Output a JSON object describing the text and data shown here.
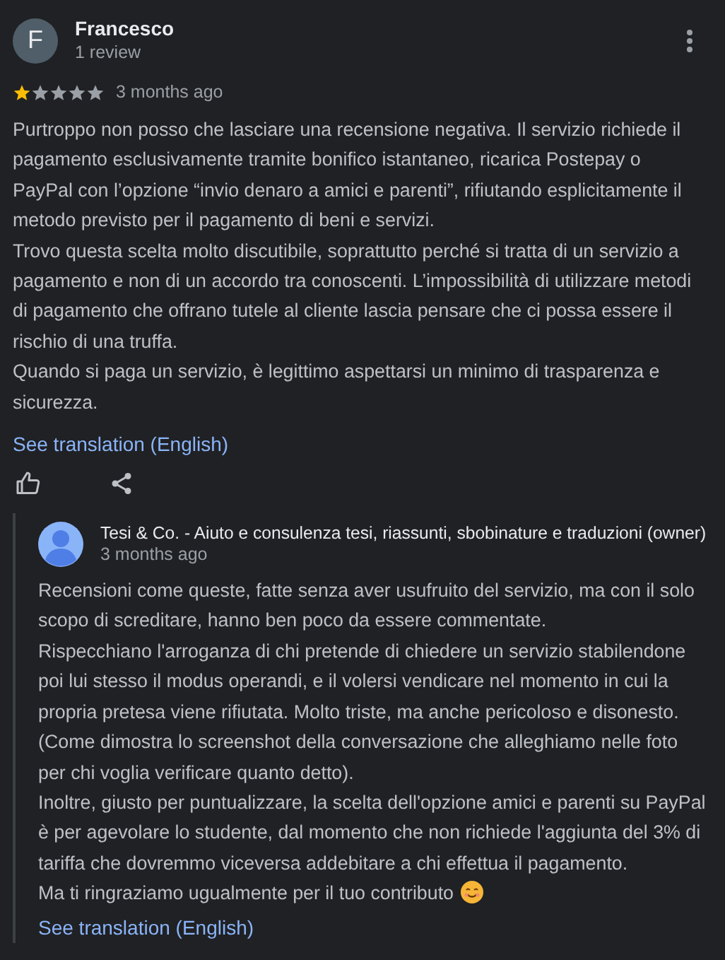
{
  "review": {
    "avatar_letter": "F",
    "author": "Francesco",
    "meta": "1 review",
    "stars": 1,
    "time": "3 months ago",
    "paragraphs": [
      "Purtroppo non posso che lasciare una recensione negativa. Il servizio richiede il pagamento esclusivamente tramite bonifico istantaneo, ricarica Postepay o PayPal con l’opzione “invio denaro a amici e parenti”, rifiutando esplicitamente il metodo previsto per il pagamento di beni e servizi.",
      "Trovo questa scelta molto discutibile, soprattutto perché si tratta di un servizio a pagamento e non di un accordo tra conoscenti. L’impossibilità di utilizzare metodi di pagamento che offrano tutele al cliente lascia pensare che ci possa essere il rischio di una truffa.",
      "Quando si paga un servizio, è legittimo aspettarsi un minimo di trasparenza e sicurezza."
    ],
    "translation_link": "See translation (English)"
  },
  "reply": {
    "author": "Tesi & Co. - Aiuto e consulenza tesi, riassunti, sbobinature e traduzioni (owner)",
    "time": "3 months ago",
    "paragraphs": [
      "Recensioni come queste, fatte senza aver usufruito del servizio, ma con il solo scopo di screditare, hanno ben poco da essere commentate.",
      "Rispecchiano l'arroganza di chi pretende di chiedere un servizio stabilendone poi lui stesso il modus operandi, e il volersi vendicare nel momento in cui la propria pretesa viene rifiutata. Molto triste, ma anche pericoloso e disonesto. (Come dimostra lo screenshot della conversazione che alleghiamo nelle foto per chi voglia verificare quanto detto).",
      "Inoltre, giusto per puntualizzare, la scelta dell'opzione amici e parenti su PayPal è per agevolare lo studente, dal momento che non richiede l'aggiunta del 3% di tariffa che dovremmo viceversa addebitare a chi effettua il pagamento.",
      "Ma ti ringraziamo ugualmente per il tuo contributo"
    ],
    "translation_link": "See translation (English)"
  }
}
